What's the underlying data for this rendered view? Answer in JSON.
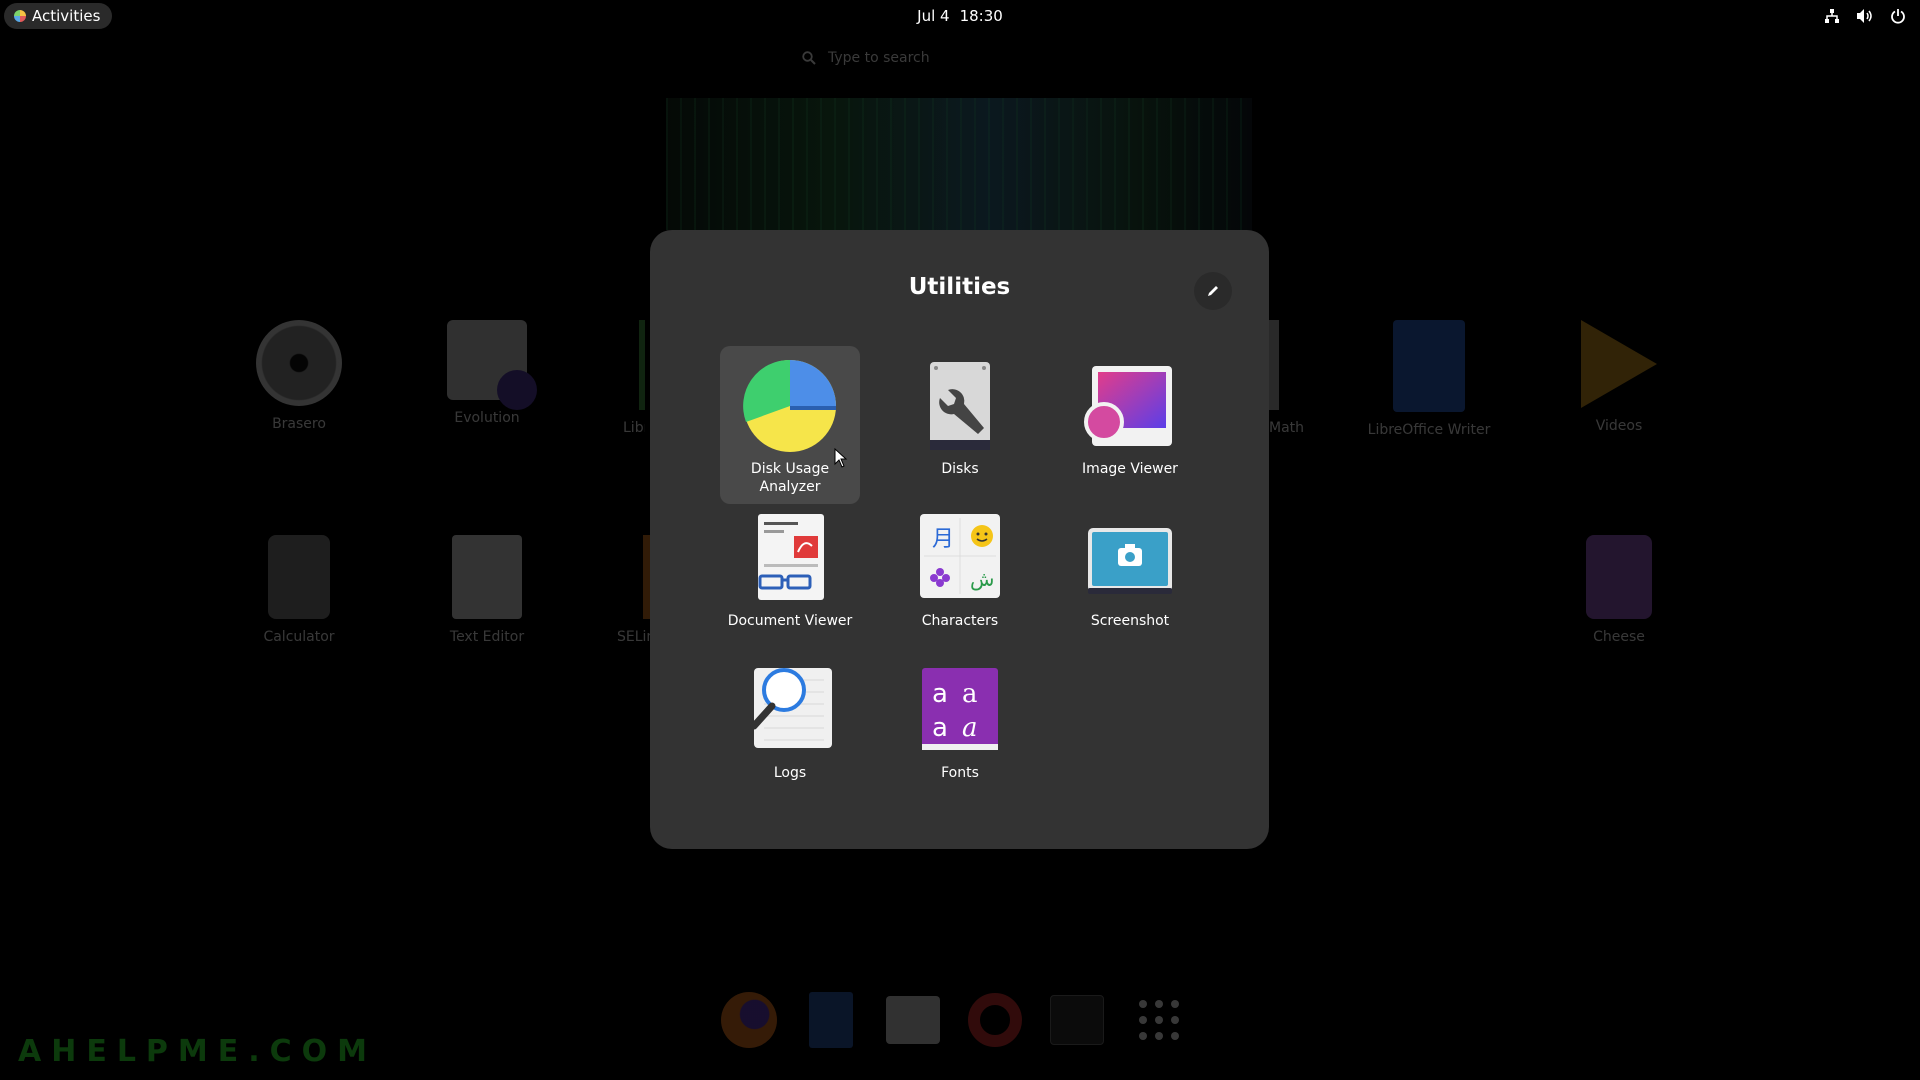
{
  "topbar": {
    "activities_label": "Activities",
    "date": "Jul 4",
    "time": "18:30",
    "tray_icons": [
      "network-icon",
      "volume-icon",
      "power-icon"
    ]
  },
  "search": {
    "placeholder": "Type to search"
  },
  "background_apps": [
    {
      "label": "Brasero",
      "icon": "brasero-icon"
    },
    {
      "label": "Evolution",
      "icon": "evolution-icon"
    },
    {
      "label": "Libr",
      "icon": "libreoffice-icon"
    },
    {
      "label": "Math",
      "icon": "libreoffice-math-icon"
    },
    {
      "label": "LibreOffice Writer",
      "icon": "libreoffice-writer-icon"
    },
    {
      "label": "Videos",
      "icon": "videos-icon"
    },
    {
      "label": "Calculator",
      "icon": "calculator-icon"
    },
    {
      "label": "Text Editor",
      "icon": "text-editor-icon"
    },
    {
      "label": "SELin",
      "icon": "selinux-icon"
    },
    {
      "label": "Cheese",
      "icon": "cheese-icon"
    }
  ],
  "folder": {
    "title": "Utilities",
    "apps": [
      {
        "label_line1": "Disk Usage",
        "label_line2": "Analyzer",
        "icon": "disk-usage-analyzer-icon",
        "selected": true
      },
      {
        "label_line1": "Disks",
        "label_line2": "",
        "icon": "disks-icon"
      },
      {
        "label_line1": "Image Viewer",
        "label_line2": "",
        "icon": "image-viewer-icon"
      },
      {
        "label_line1": "Document Viewer",
        "label_line2": "",
        "icon": "document-viewer-icon"
      },
      {
        "label_line1": "Characters",
        "label_line2": "",
        "icon": "characters-icon"
      },
      {
        "label_line1": "Screenshot",
        "label_line2": "",
        "icon": "screenshot-icon"
      },
      {
        "label_line1": "Logs",
        "label_line2": "",
        "icon": "logs-icon"
      },
      {
        "label_line1": "Fonts",
        "label_line2": "",
        "icon": "fonts-icon"
      }
    ]
  },
  "dash": [
    "firefox-icon",
    "files-icon",
    "software-icon",
    "help-icon",
    "terminal-icon",
    "show-apps-icon"
  ],
  "watermark": "AHELPME.COM"
}
